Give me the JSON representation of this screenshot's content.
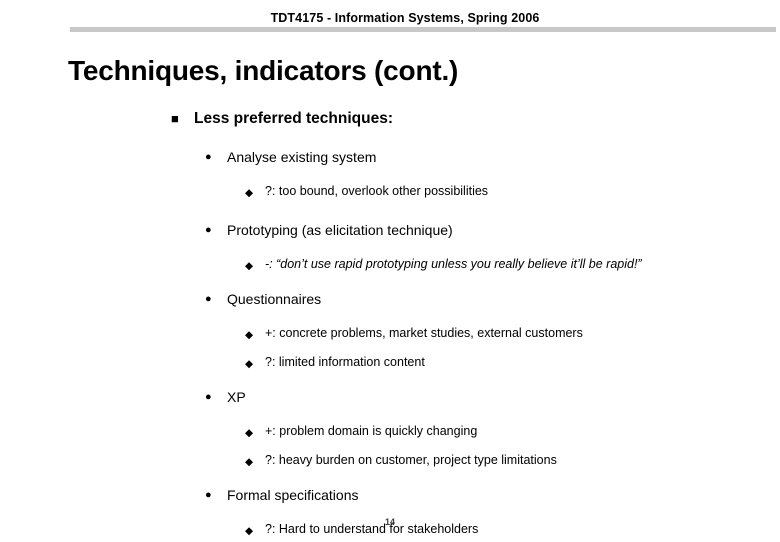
{
  "slide": {
    "header": "TDT4175 -  Information Systems, Spring 2006",
    "title": "Techniques, indicators (cont.)",
    "page_number": "14",
    "rule_color": "#c8c8c8",
    "text_color": "#000000",
    "background_color": "#ffffff",
    "bullets": {
      "square": "■",
      "round": "●",
      "diamond": "◆"
    },
    "content": {
      "level1": "Less preferred techniques:",
      "items": [
        {
          "label": "Analyse existing system",
          "sub": [
            {
              "text": "?: too bound, overlook other possibilities",
              "italic": false
            }
          ]
        },
        {
          "label": "Prototyping (as elicitation technique)",
          "sub": [
            {
              "text": "-: “don’t use rapid prototyping unless you really believe it’ll be rapid!”",
              "italic": true
            }
          ]
        },
        {
          "label": "Questionnaires",
          "sub": [
            {
              "text": "+: concrete problems, market studies, external customers",
              "italic": false
            },
            {
              "text": "?: limited information content",
              "italic": false
            }
          ]
        },
        {
          "label": "XP",
          "sub": [
            {
              "text": "+: problem domain is quickly changing",
              "italic": false
            },
            {
              "text": "?: heavy burden on customer, project type limitations",
              "italic": false
            }
          ]
        },
        {
          "label": "Formal specifications",
          "sub": [
            {
              "text": "?: Hard to understand for stakeholders",
              "italic": false
            }
          ]
        }
      ]
    }
  }
}
